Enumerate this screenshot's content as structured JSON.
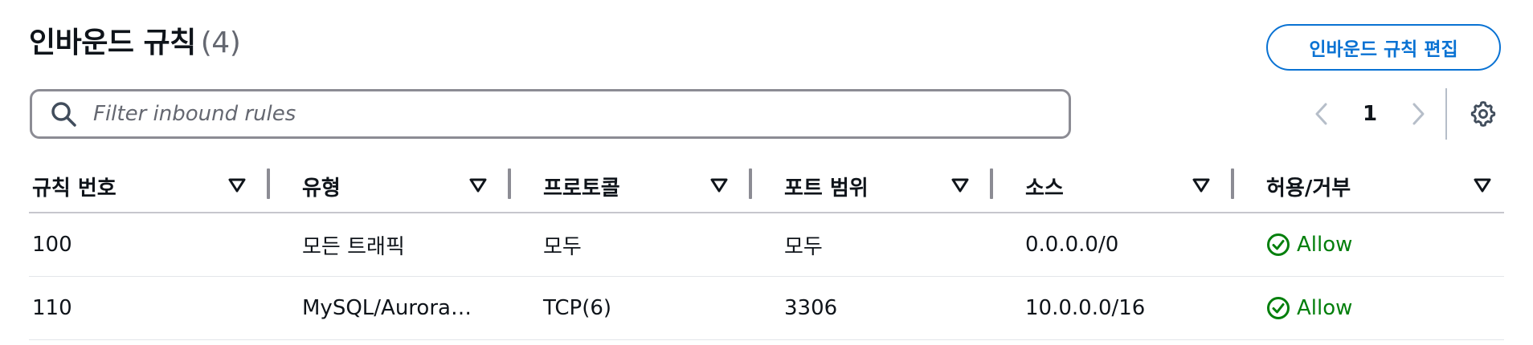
{
  "header": {
    "title": "인바운드 규칙",
    "count": "(4)",
    "edit_button_label": "인바운드 규칙 편집"
  },
  "search": {
    "placeholder": "Filter inbound rules",
    "value": ""
  },
  "pagination": {
    "current_page": "1"
  },
  "table": {
    "columns": [
      "규칙 번호",
      "유형",
      "프로토콜",
      "포트 범위",
      "소스",
      "허용/거부"
    ],
    "rows": [
      {
        "rule_number": "100",
        "type": "모든 트래픽",
        "protocol": "모두",
        "port_range": "모두",
        "source": "0.0.0.0/0",
        "action": "Allow"
      },
      {
        "rule_number": "110",
        "type": "MySQL/Aurora…",
        "protocol": "TCP(6)",
        "port_range": "3306",
        "source": "10.0.0.0/16",
        "action": "Allow"
      }
    ]
  },
  "colors": {
    "primary": "#0972d3",
    "success": "#037f0c",
    "text": "#0f141a",
    "muted": "#656871"
  },
  "icons": {
    "search": "search-icon",
    "prev": "chevron-left-icon",
    "next": "chevron-right-icon",
    "settings": "gear-icon",
    "sort": "caret-down-icon",
    "status": "check-circle-icon"
  }
}
